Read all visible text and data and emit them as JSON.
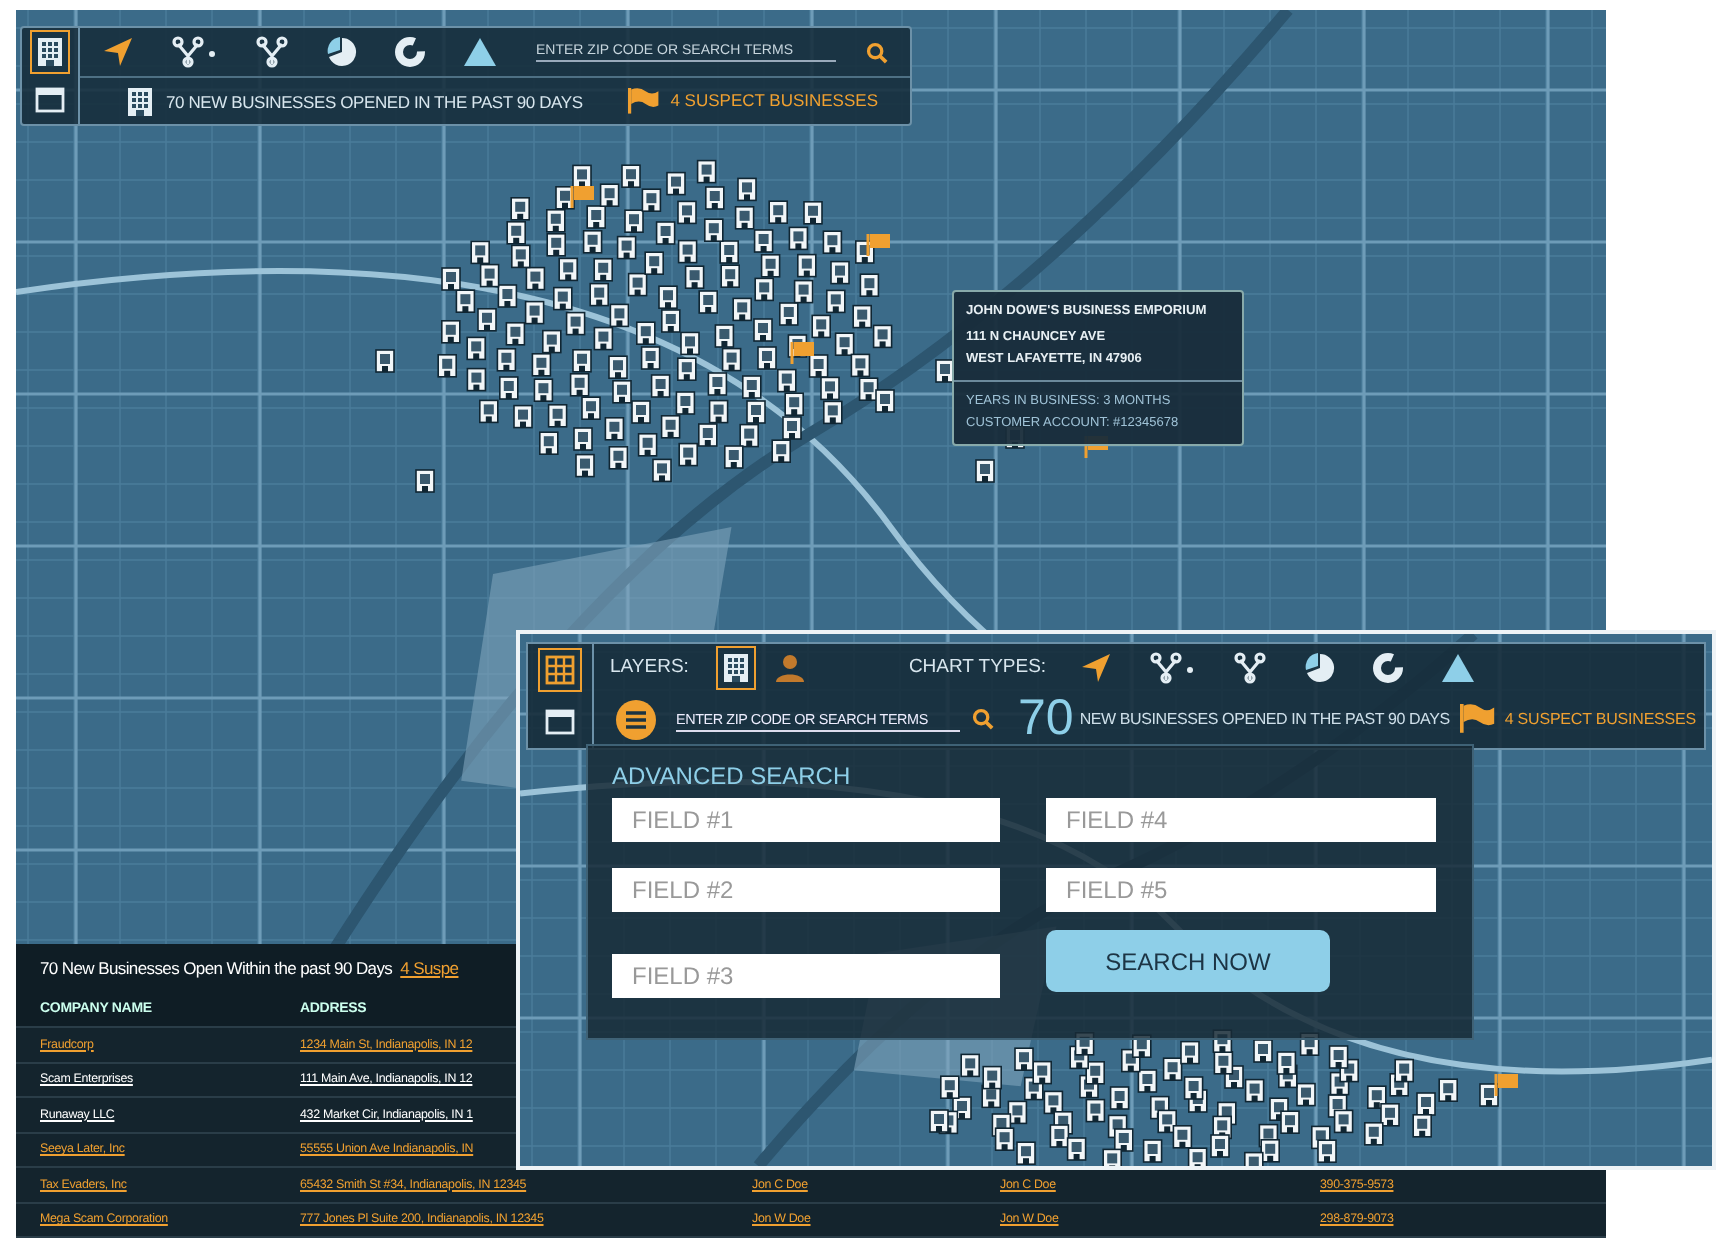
{
  "main_toolbar": {
    "view_buttons": [
      {
        "kind": "buildings",
        "selected": true
      },
      {
        "kind": "table",
        "selected": false
      }
    ],
    "chart_types": [
      {
        "kind": "navigate"
      },
      {
        "kind": "network-dot"
      },
      {
        "kind": "network"
      },
      {
        "kind": "pie"
      },
      {
        "kind": "donut"
      },
      {
        "kind": "triangle"
      }
    ],
    "search": {
      "placeholder": "ENTER ZIP CODE OR SEARCH TERMS"
    },
    "summary": "70 NEW BUSINESSES OPENED IN THE PAST 90 DAYS",
    "suspect": "4 SUSPECT BUSINESSES"
  },
  "tooltip": {
    "title": "JOHN DOWE'S BUSINESS EMPORIUM",
    "address_lines": [
      "111 N CHAUNCEY AVE",
      "WEST LAFAYETTE, IN 47906"
    ],
    "details": [
      "YEARS IN BUSINESS: 3 MONTHS",
      "CUSTOMER ACCOUNT: #12345678"
    ]
  },
  "table": {
    "heading": "70 New Businesses Open Within the past 90 Days",
    "suspect_link": "4 Suspe",
    "columns": [
      "COMPANY NAME",
      "ADDRESS"
    ],
    "rows": [
      {
        "flagged": true,
        "cells": [
          "Fraudcorp",
          "1234 Main St, Indianapolis, IN 12"
        ]
      },
      {
        "flagged": false,
        "cells": [
          "Scam Enterprises",
          "111 Main Ave, Indianapolis, IN 12"
        ]
      },
      {
        "flagged": false,
        "cells": [
          "Runaway LLC",
          "432 Market Cir, Indianapolis, IN 1"
        ]
      },
      {
        "flagged": true,
        "cells": [
          "Seeya Later, Inc",
          "55555 Union Ave Indianapolis, IN"
        ]
      },
      {
        "flagged": true,
        "cells": [
          "Tax Evaders, Inc",
          "65432 Smith St #34, Indianapolis, IN 12345",
          "Jon C Doe",
          "Jon C Doe",
          "390-375-9573"
        ]
      },
      {
        "flagged": true,
        "cells": [
          "Mega Scam Corporation",
          "777 Jones Pl Suite 200, Indianapolis, IN 12345",
          "Jon W Doe",
          "Jon W Doe",
          "298-879-9073"
        ]
      }
    ]
  },
  "search_window": {
    "view_buttons": [
      {
        "kind": "grid",
        "selected": true
      },
      {
        "kind": "table",
        "selected": false
      }
    ],
    "layers_label": "LAYERS:",
    "layers": [
      {
        "kind": "buildings",
        "selected": true
      },
      {
        "kind": "person",
        "selected": false
      }
    ],
    "chart_types_label": "CHART TYPES:",
    "chart_types": [
      {
        "kind": "navigate"
      },
      {
        "kind": "network-dot"
      },
      {
        "kind": "network"
      },
      {
        "kind": "pie"
      },
      {
        "kind": "donut"
      },
      {
        "kind": "triangle"
      }
    ],
    "search": {
      "placeholder": "ENTER ZIP CODE OR SEARCH TERMS"
    },
    "count": "70",
    "summary": "NEW BUSINESSES OPENED IN THE PAST 90 DAYS",
    "suspect": "4 SUSPECT BUSINESSES",
    "advanced_search": {
      "title": "ADVANCED SEARCH",
      "fields": [
        {
          "placeholder": "FIELD #1"
        },
        {
          "placeholder": "FIELD #2"
        },
        {
          "placeholder": "FIELD #3"
        },
        {
          "placeholder": "FIELD #4"
        },
        {
          "placeholder": "FIELD #5"
        }
      ],
      "button": "SEARCH NOW"
    }
  }
}
